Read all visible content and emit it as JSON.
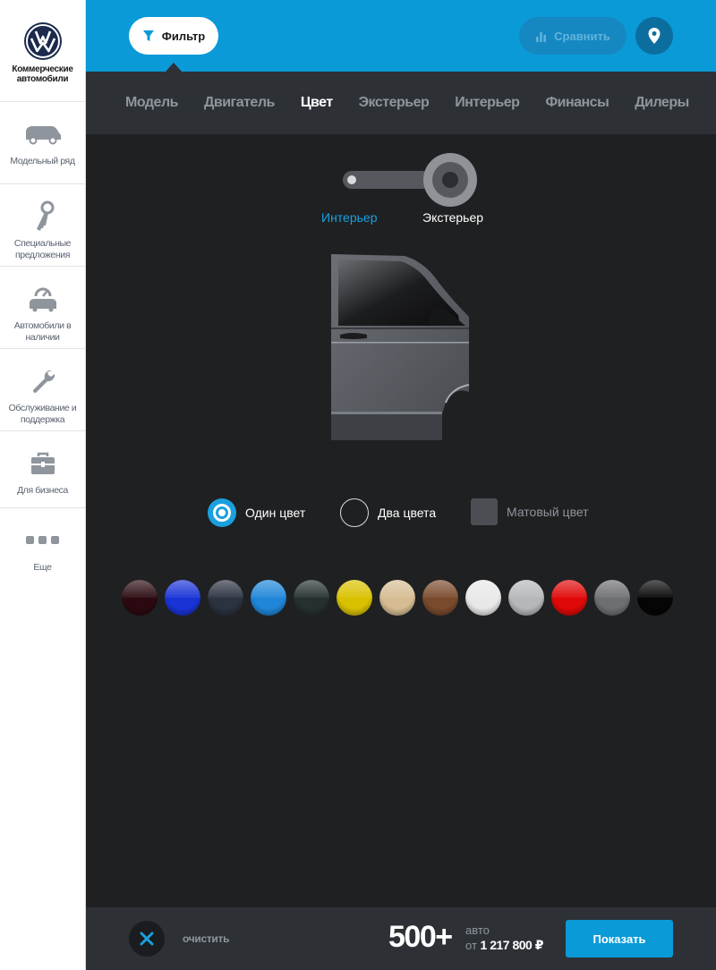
{
  "brand": {
    "line1": "Коммерческие",
    "line2": "автомобили"
  },
  "sidebar": {
    "items": [
      {
        "label": "Модельный ряд",
        "icon": "van-icon"
      },
      {
        "label": "Специальные предложения",
        "icon": "keys-icon"
      },
      {
        "label": "Автомобили в наличии",
        "icon": "car-stock-icon"
      },
      {
        "label": "Обслуживание и поддержка",
        "icon": "wrench-icon"
      },
      {
        "label": "Для бизнеса",
        "icon": "briefcase-icon"
      },
      {
        "label": "Еще",
        "icon": "more-dots-icon"
      }
    ]
  },
  "header": {
    "filter_label": "Фильтр",
    "compare_label": "Сравнить",
    "accent_color": "#0a9ad7"
  },
  "tabs": [
    {
      "label": "Модель",
      "active": false
    },
    {
      "label": "Двигатель",
      "active": false
    },
    {
      "label": "Цвет",
      "active": true
    },
    {
      "label": "Экстерьер",
      "active": false
    },
    {
      "label": "Интерьер",
      "active": false
    },
    {
      "label": "Финансы",
      "active": false
    },
    {
      "label": "Дилеры",
      "active": false
    }
  ],
  "view_toggle": {
    "left_label": "Интерьер",
    "right_label": "Экстерьер",
    "selected": "Экстерьер"
  },
  "color_types": [
    {
      "label": "Один цвет",
      "selected": true
    },
    {
      "label": "Два цвета",
      "selected": false
    },
    {
      "label": "Матовый цвет",
      "selected": false
    }
  ],
  "swatches": [
    {
      "name": "dark-cherry",
      "color": "#2a0a10"
    },
    {
      "name": "blue",
      "color": "#1a33d6"
    },
    {
      "name": "dark-grey-blue",
      "color": "#2b3240"
    },
    {
      "name": "light-blue",
      "color": "#1f86d8"
    },
    {
      "name": "dark-green-grey",
      "color": "#25312f"
    },
    {
      "name": "yellow",
      "color": "#d9c100"
    },
    {
      "name": "beige",
      "color": "#d6bc92"
    },
    {
      "name": "brown",
      "color": "#7a4a2c"
    },
    {
      "name": "white",
      "color": "#e8e8e8"
    },
    {
      "name": "silver",
      "color": "#b5b7b9"
    },
    {
      "name": "red",
      "color": "#e00808"
    },
    {
      "name": "grey",
      "color": "#6e6f71"
    },
    {
      "name": "black",
      "color": "#050505"
    }
  ],
  "footer": {
    "clear_label": "очистить",
    "count": "500+",
    "unit": "авто",
    "price_prefix": "от",
    "price": "1 217 800 ₽",
    "show_label": "Показать"
  }
}
